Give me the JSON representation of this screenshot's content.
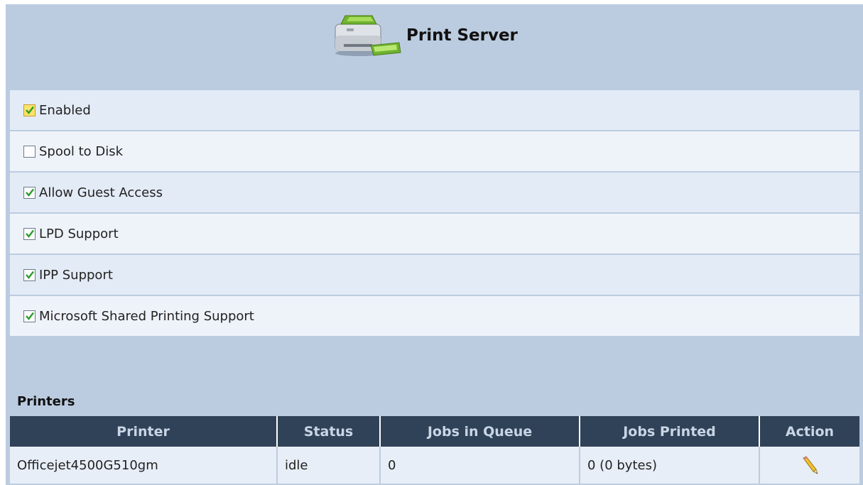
{
  "header": {
    "title": "Print Server",
    "icon": "printer-icon"
  },
  "options": [
    {
      "label": "Enabled",
      "checked": true
    },
    {
      "label": "Spool to Disk",
      "checked": false
    },
    {
      "label": "Allow Guest Access",
      "checked": true
    },
    {
      "label": "LPD Support",
      "checked": true
    },
    {
      "label": "IPP Support",
      "checked": true
    },
    {
      "label": "Microsoft Shared Printing Support",
      "checked": true
    }
  ],
  "printers": {
    "title": "Printers",
    "columns": [
      "Printer",
      "Status",
      "Jobs in Queue",
      "Jobs Printed",
      "Action"
    ],
    "rows": [
      {
        "printer": "Officejet4500G510gm",
        "status": "idle",
        "jobs_in_queue": "0",
        "jobs_printed": "0 (0 bytes)",
        "action_icon": "edit-pencil-icon"
      }
    ]
  },
  "colors": {
    "panel_bg": "#bccce0",
    "table_header_bg": "#304257",
    "status_idle": "#2e7d2e",
    "check": "#2a9d2a"
  }
}
